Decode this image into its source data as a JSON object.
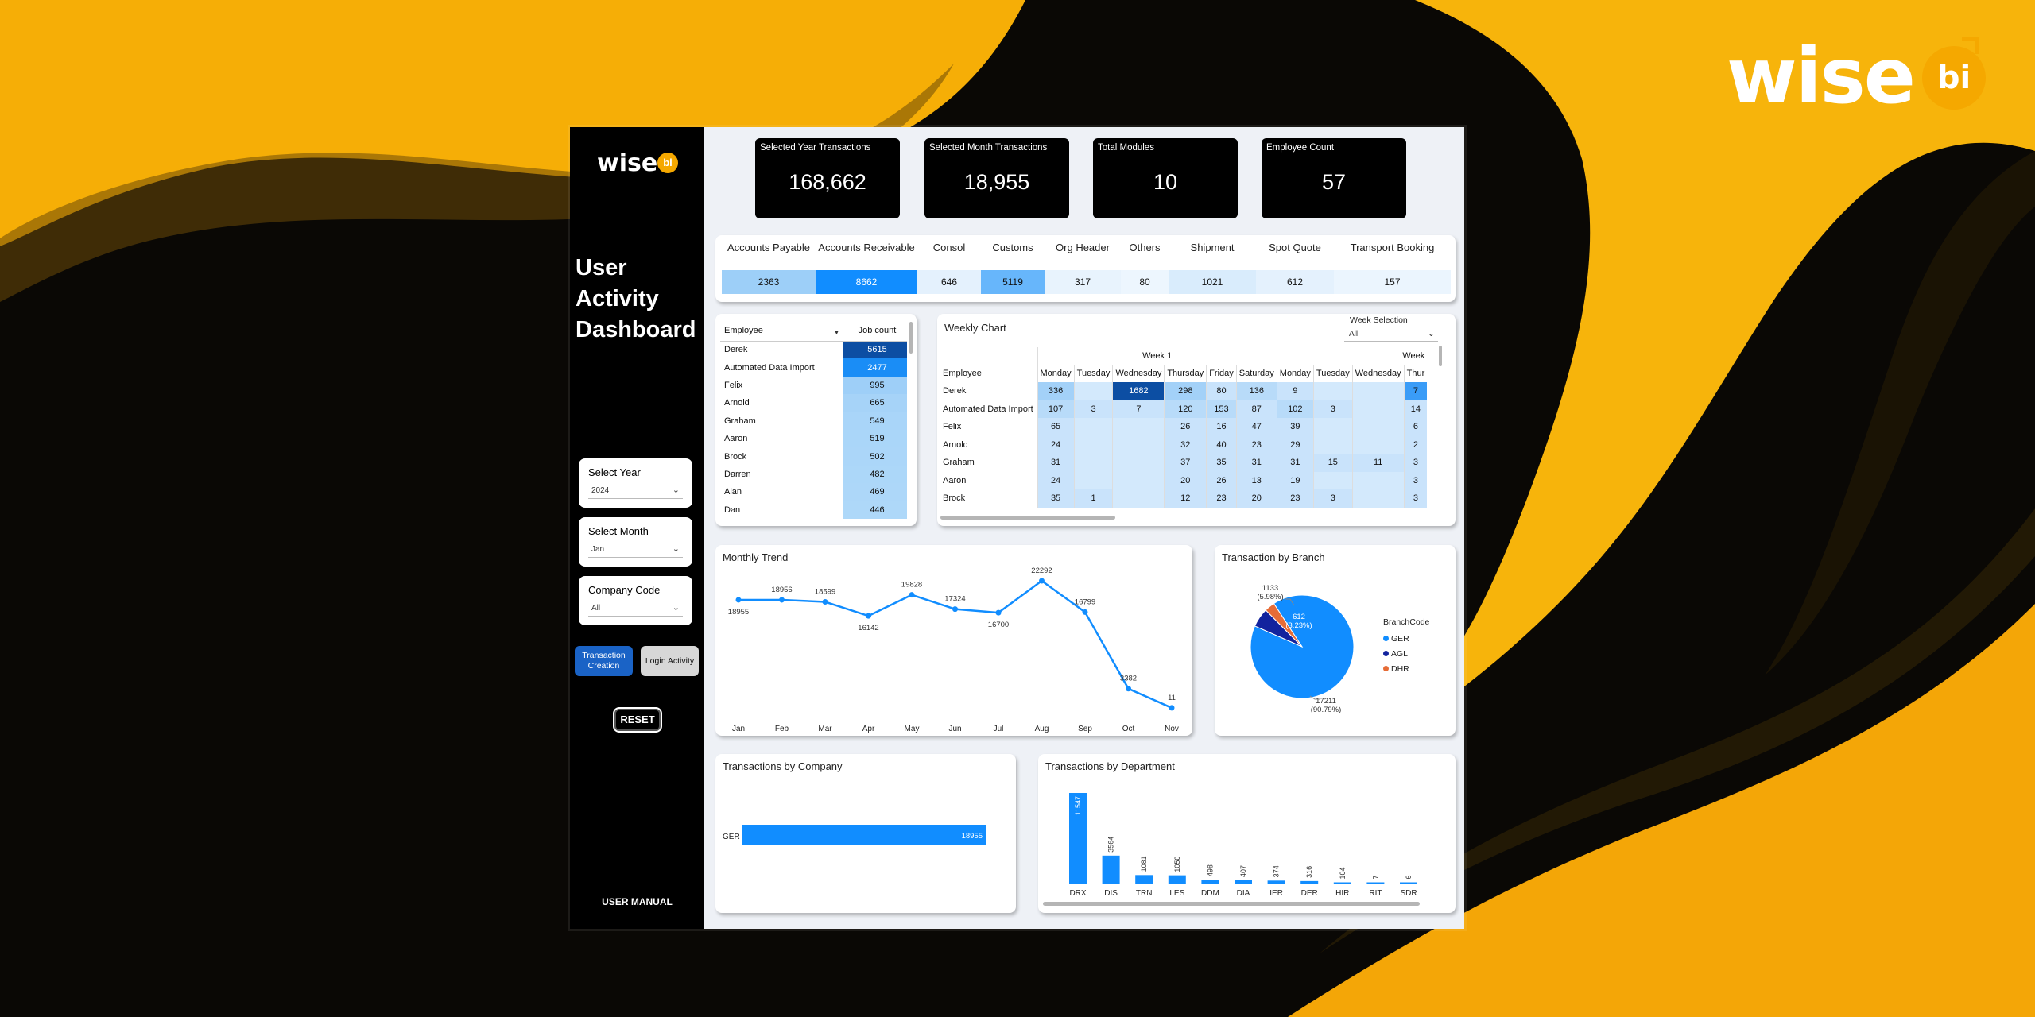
{
  "brand": {
    "word": "wise",
    "badge": "bi"
  },
  "sidebar": {
    "logo_word": "wise",
    "logo_badge": "bi",
    "title_lines": [
      "User",
      "Activity",
      "Dashboard"
    ],
    "slicers": [
      {
        "label": "Select Year",
        "value": "2024"
      },
      {
        "label": "Select Month",
        "value": "Jan"
      },
      {
        "label": "Company Code",
        "value": "All"
      }
    ],
    "nav": {
      "active": "Transaction Creation",
      "inactive": "Login Activity"
    },
    "reset": "RESET",
    "manual": "USER MANUAL"
  },
  "kpis": [
    {
      "label": "Selected Year Transactions",
      "value": "168,662"
    },
    {
      "label": "Selected Month Transactions",
      "value": "18,955"
    },
    {
      "label": "Total Modules",
      "value": "10"
    },
    {
      "label": "Employee Count",
      "value": "57"
    }
  ],
  "modules": [
    {
      "name": "Accounts Payable",
      "value": "2363",
      "color": "#9dcff8"
    },
    {
      "name": "Accounts Receivable",
      "value": "8662",
      "color": "#118dff"
    },
    {
      "name": "Consol",
      "value": "646",
      "color": "#e4f1fd"
    },
    {
      "name": "Customs",
      "value": "5119",
      "color": "#67b6fb"
    },
    {
      "name": "Org Header",
      "value": "317",
      "color": "#e8f3fd"
    },
    {
      "name": "Others",
      "value": "80",
      "color": "#edf6fe"
    },
    {
      "name": "Shipment",
      "value": "1021",
      "color": "#d9ecfc"
    },
    {
      "name": "Spot Quote",
      "value": "612",
      "color": "#e4f1fd"
    },
    {
      "name": "Transport Booking",
      "value": "157",
      "color": "#ebf5fe"
    }
  ],
  "employee_table": {
    "headers": [
      "Employee",
      "Job count"
    ],
    "rows": [
      {
        "name": "Derek",
        "count": "5615",
        "color": "#0c4ea3"
      },
      {
        "name": "Automated Data Import",
        "count": "2477",
        "color": "#1a8df6"
      },
      {
        "name": "Felix",
        "count": "995",
        "color": "#9ecff8"
      },
      {
        "name": "Arnold",
        "count": "665",
        "color": "#a6d3f8"
      },
      {
        "name": "Graham",
        "count": "549",
        "color": "#a9d5f9"
      },
      {
        "name": "Aaron",
        "count": "519",
        "color": "#aad6f9"
      },
      {
        "name": "Brock",
        "count": "502",
        "color": "#abd6f9"
      },
      {
        "name": "Darren",
        "count": "482",
        "color": "#acd7f9"
      },
      {
        "name": "Alan",
        "count": "469",
        "color": "#add7f9"
      },
      {
        "name": "Dan",
        "count": "446",
        "color": "#aed8f9"
      }
    ]
  },
  "weekly": {
    "title": "Weekly Chart",
    "selection_label": "Week Selection",
    "selection_value": "All",
    "week_labels": [
      "Week 1",
      "Week"
    ],
    "employee_header": "Employee",
    "days": [
      "Monday",
      "Tuesday",
      "Wednesday",
      "Thursday",
      "Friday",
      "Saturday",
      "Monday",
      "Tuesday",
      "Wednesday",
      "Thur"
    ],
    "rows": [
      {
        "name": "Derek",
        "cells": [
          "336",
          "",
          "1682",
          "298",
          "80",
          "136",
          "9",
          "",
          "",
          "7"
        ]
      },
      {
        "name": "Automated Data Import",
        "cells": [
          "107",
          "3",
          "7",
          "120",
          "153",
          "87",
          "102",
          "3",
          "",
          "14"
        ]
      },
      {
        "name": "Felix",
        "cells": [
          "65",
          "",
          "",
          "26",
          "16",
          "47",
          "39",
          "",
          "",
          "6"
        ]
      },
      {
        "name": "Arnold",
        "cells": [
          "24",
          "",
          "",
          "32",
          "40",
          "23",
          "29",
          "",
          "",
          "2"
        ]
      },
      {
        "name": "Graham",
        "cells": [
          "31",
          "",
          "",
          "37",
          "35",
          "31",
          "31",
          "15",
          "11",
          "3"
        ]
      },
      {
        "name": "Aaron",
        "cells": [
          "24",
          "",
          "",
          "20",
          "26",
          "13",
          "19",
          "",
          "",
          "3"
        ]
      },
      {
        "name": "Brock",
        "cells": [
          "35",
          "1",
          "",
          "12",
          "23",
          "20",
          "23",
          "3",
          "",
          "3"
        ]
      }
    ]
  },
  "monthly_trend": {
    "title": "Monthly Trend",
    "chart_data": {
      "type": "line",
      "x": [
        "Jan",
        "Feb",
        "Mar",
        "Apr",
        "May",
        "Jun",
        "Jul",
        "Aug",
        "Sep",
        "Oct",
        "Nov"
      ],
      "values": [
        18955,
        18956,
        18599,
        16142,
        19828,
        17324,
        16700,
        22292,
        16799,
        3382,
        11
      ],
      "labels": [
        "18955",
        "18956",
        "18599",
        "16142",
        "19828",
        "17324",
        "16700",
        "22292",
        "16799",
        "3382",
        "11"
      ],
      "color": "#118dff"
    }
  },
  "branch": {
    "title": "Transaction by Branch",
    "legend_title": "BranchCode",
    "chart_data": {
      "type": "pie",
      "labels": [
        "GER",
        "AGL",
        "DHR"
      ],
      "values": [
        17211,
        1133,
        612
      ],
      "colors": [
        "#118dff",
        "#12239e",
        "#e66c37"
      ],
      "data_labels": [
        {
          "value": "17211",
          "pct": "(90.79%)"
        },
        {
          "value": "1133",
          "pct": "(5.98%)"
        },
        {
          "value": "612",
          "pct": "(3.23%)"
        }
      ]
    }
  },
  "company": {
    "title": "Transactions by Company",
    "chart_data": {
      "type": "bar",
      "categories": [
        "GER"
      ],
      "values": [
        18955
      ],
      "color": "#118dff"
    }
  },
  "department": {
    "title": "Transactions by Department",
    "chart_data": {
      "type": "bar",
      "categories": [
        "DRX",
        "DIS",
        "TRN",
        "LES",
        "DDM",
        "DIA",
        "IER",
        "DER",
        "HIR",
        "RIT",
        "SDR"
      ],
      "values": [
        11547,
        3564,
        1081,
        1050,
        498,
        407,
        374,
        316,
        104,
        7,
        6
      ],
      "color": "#118dff"
    }
  }
}
